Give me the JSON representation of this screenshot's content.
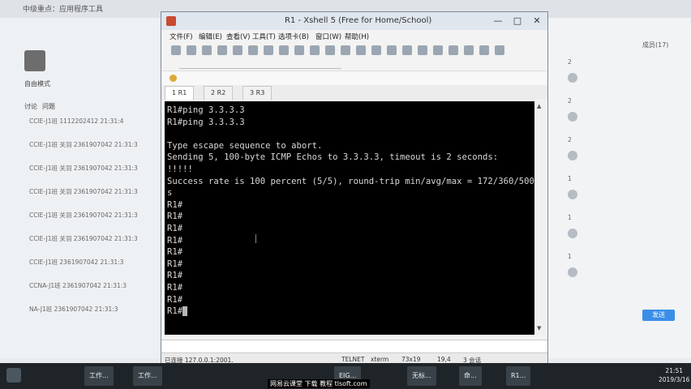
{
  "window": {
    "title": "R1 - Xshell 5 (Free for Home/School)",
    "min": "—",
    "max": "□",
    "close": "✕"
  },
  "menu": [
    "文件(F)",
    "编辑(E)",
    "查看(V)",
    "工具(T)",
    "选项卡(B)",
    "窗口(W)",
    "帮助(H)"
  ],
  "tabs": [
    "1 R1",
    "2 R2",
    "3 R3"
  ],
  "terminal": {
    "lines": [
      "R1#ping 3.3.3.3",
      "R1#ping 3.3.3.3",
      "",
      "Type escape sequence to abort.",
      "Sending 5, 100-byte ICMP Echos to 3.3.3.3, timeout is 2 seconds:",
      "!!!!!",
      "Success rate is 100 percent (5/5), round-trip min/avg/max = 172/360/500 m",
      "s",
      "R1#",
      "R1#",
      "R1#",
      "R1#",
      "R1#",
      "R1#",
      "R1#",
      "R1#",
      "R1#",
      "R1#"
    ]
  },
  "status": {
    "host": "已连接 127.0.0.1:2001.",
    "protocol": "TELNET",
    "term": "xterm",
    "size": "73x19",
    "pos": "19,4",
    "sessions": "3 会话"
  },
  "background": {
    "app_title": "中级重点：应用程序工具",
    "left_header": "自由模式",
    "discussion": "讨论",
    "question": "问题",
    "list_items": [
      "CCIE-J1班 1112202412 21:31:4",
      "CCIE-J1班 关羽 2361907042 21:31:3",
      "CCIE-J1班 关羽 2361907042 21:31:3",
      "CCIE-J1班 关羽 2361907042 21:31:3",
      "CCIE-J1班 关羽 2361907042 21:31:3",
      "CCIE-J1班 关羽 2361907042 21:31:3",
      "CCIE-J1班 2361907042 21:31:3",
      "CCNA-J1班 2361907042 21:31:3",
      "NA-J1班 2361907042 21:31:3"
    ],
    "right_count": "成员(17)",
    "right_items": [
      "2",
      "2",
      "2",
      "1",
      "1",
      "1"
    ],
    "send": "发送"
  },
  "taskbar": {
    "items": [
      "工作...",
      "工作...",
      "EIG...",
      "无标...",
      "命...",
      "R1..."
    ],
    "time": "21:51",
    "date": "2019/3/16"
  },
  "watermark": "网易云课堂 下载 教程 tlsoft.com"
}
